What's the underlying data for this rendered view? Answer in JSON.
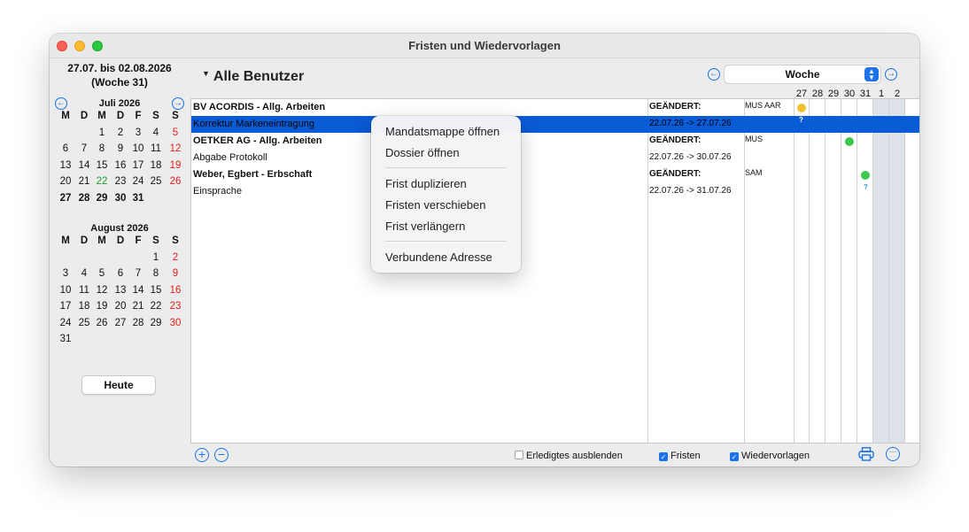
{
  "window": {
    "title": "Fristen und Wiedervorlagen"
  },
  "sidebar": {
    "range_line1": "27.07. bis 02.08.2026",
    "range_line2": "(Woche 31)",
    "weekday_headers": [
      "M",
      "D",
      "M",
      "D",
      "F",
      "S",
      "S"
    ],
    "july": {
      "title": "Juli 2026",
      "rows": [
        [
          "",
          "",
          "1",
          "2",
          "3",
          "4",
          "5"
        ],
        [
          "6",
          "7",
          "8",
          "9",
          "10",
          "11",
          "12"
        ],
        [
          "13",
          "14",
          "15",
          "16",
          "17",
          "18",
          "19"
        ],
        [
          "20",
          "21",
          "22",
          "23",
          "24",
          "25",
          "26"
        ],
        [
          "27",
          "28",
          "29",
          "30",
          "31",
          "",
          ""
        ]
      ]
    },
    "august": {
      "title": "August 2026",
      "rows": [
        [
          "",
          "",
          "",
          "",
          "",
          "1",
          "2"
        ],
        [
          "3",
          "4",
          "5",
          "6",
          "7",
          "8",
          "9"
        ],
        [
          "10",
          "11",
          "12",
          "13",
          "14",
          "15",
          "16"
        ],
        [
          "17",
          "18",
          "19",
          "20",
          "21",
          "22",
          "23"
        ],
        [
          "24",
          "25",
          "26",
          "27",
          "28",
          "29",
          "30"
        ],
        [
          "31",
          "",
          "",
          "",
          "",
          "",
          ""
        ]
      ]
    },
    "today_label": "Heute",
    "prev_icon": "←",
    "next_icon": "→"
  },
  "header": {
    "user_filter": "Alle Benutzer",
    "view_mode": "Woche",
    "day_headers": [
      "27",
      "28",
      "29",
      "30",
      "31",
      "1",
      "2"
    ]
  },
  "rows": [
    {
      "title": "BV ACORDIS - Allg. Arbeiten",
      "bold": true,
      "changed": "GEÄNDERT:",
      "user": "MUS AAR"
    },
    {
      "title": "Korrektur Markeneintragung",
      "bold": false,
      "changed": "22.07.26 -> 27.07.26",
      "user": ""
    },
    {
      "title": "OETKER AG - Allg. Arbeiten",
      "bold": true,
      "changed": "GEÄNDERT:",
      "user": "MUS"
    },
    {
      "title": "Abgabe Protokoll",
      "bold": false,
      "changed": "22.07.26 -> 30.07.26",
      "user": ""
    },
    {
      "title": "Weber, Egbert - Erbschaft",
      "bold": true,
      "changed": "GEÄNDERT:",
      "user": "SAM"
    },
    {
      "title": "Einsprache",
      "bold": false,
      "changed": "22.07.26 -> 31.07.26",
      "user": ""
    }
  ],
  "markers": {
    "question": "?",
    "colors": {
      "yellow": "#f2c12e",
      "green": "#3ec94e",
      "selection": "#0a5bd6",
      "accent": "#1a73e8"
    }
  },
  "context_menu": {
    "items": [
      "Mandatsmappe öffnen",
      "Dossier öffnen",
      "Frist duplizieren",
      "Fristen verschieben",
      "Frist verlängern",
      "Verbundene Adresse"
    ]
  },
  "bottom": {
    "hide_done": "Erledigtes ausblenden",
    "deadlines": "Fristen",
    "resubmissions": "Wiedervorlagen",
    "add_icon": "+",
    "remove_icon": "−",
    "more_icon": "···"
  }
}
